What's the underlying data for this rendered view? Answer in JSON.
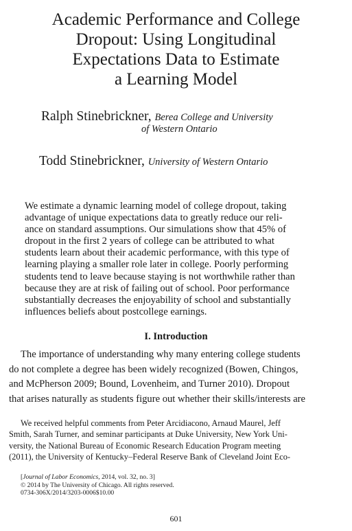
{
  "title_lines": [
    "Academic Performance and College",
    "Dropout: Using Longitudinal",
    "Expectations Data to Estimate",
    "a Learning Model"
  ],
  "authors": [
    {
      "name": "Ralph Stinebrickner,",
      "affiliation_line1": "Berea College and University",
      "affiliation_line2": "of Western Ontario"
    },
    {
      "name": "Todd Stinebrickner,",
      "affiliation_line1": "University of Western Ontario"
    }
  ],
  "abstract_lines": [
    "We estimate a dynamic learning model of college dropout, taking",
    "advantage of unique expectations data to greatly reduce our reli-",
    "ance on standard assumptions. Our simulations show that 45% of",
    "dropout in the first 2 years of college can be attributed to what",
    "students learn about their academic performance, with this type of",
    "learning playing a smaller role later in college. Poorly performing",
    "students tend to leave because staying is not worthwhile rather than",
    "because they are at risk of failing out of school. Poor performance",
    "substantially decreases the enjoyability of school and substantially",
    "influences beliefs about postcollege earnings."
  ],
  "section_heading": "I. Introduction",
  "intro_lines": [
    "The importance of understanding why many entering college students",
    "do not complete a degree has been widely recognized (Bowen, Chingos,",
    "and McPherson 2009; Bound, Lovenheim, and Turner 2010). Dropout",
    "that arises naturally as students figure out whether their skills/interests are"
  ],
  "footnote_lines": [
    "We received helpful comments from Peter Arcidiacono, Arnaud Maurel, Jeff",
    "Smith, Sarah Turner, and seminar participants at Duke University, New York Uni-",
    "versity, the National Bureau of Economic Research Education Program meeting",
    "(2011), the University of Kentucky–Federal Reserve Bank of Cleveland Joint Eco-"
  ],
  "journal": {
    "name": "Journal of Labor Economics,",
    "citation_rest": " 2014, vol. 32, no. 3]",
    "copyright": "© 2014 by The University of Chicago. All rights reserved.",
    "code": "0734-306X/2014/3203-0006$10.00"
  },
  "page_number": "601"
}
